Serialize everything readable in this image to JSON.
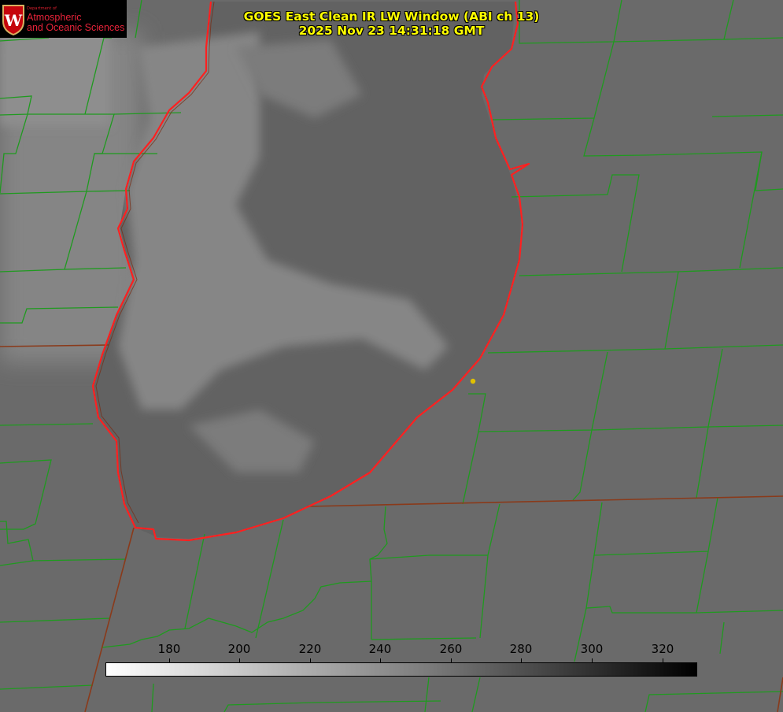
{
  "title": {
    "main": "GOES East Clean IR LW Window (ABI ch 13)",
    "timestamp": "2025 Nov 23 14:31:18 GMT"
  },
  "logo": {
    "department": "Department of",
    "line1": "Atmospheric",
    "line2": "and Oceanic Sciences",
    "seal_letter": "W"
  },
  "colorbar": {
    "ticks": [
      "180",
      "200",
      "220",
      "240",
      "260",
      "280",
      "300",
      "320"
    ],
    "colormap": "white-to-black grayscale"
  },
  "colors": {
    "county_lines": "#1f9a1f",
    "state_lines": "#8a3a1a",
    "lake_outline": "#ff2020",
    "marker": "#e0c000",
    "title_text": "#ffff00"
  }
}
